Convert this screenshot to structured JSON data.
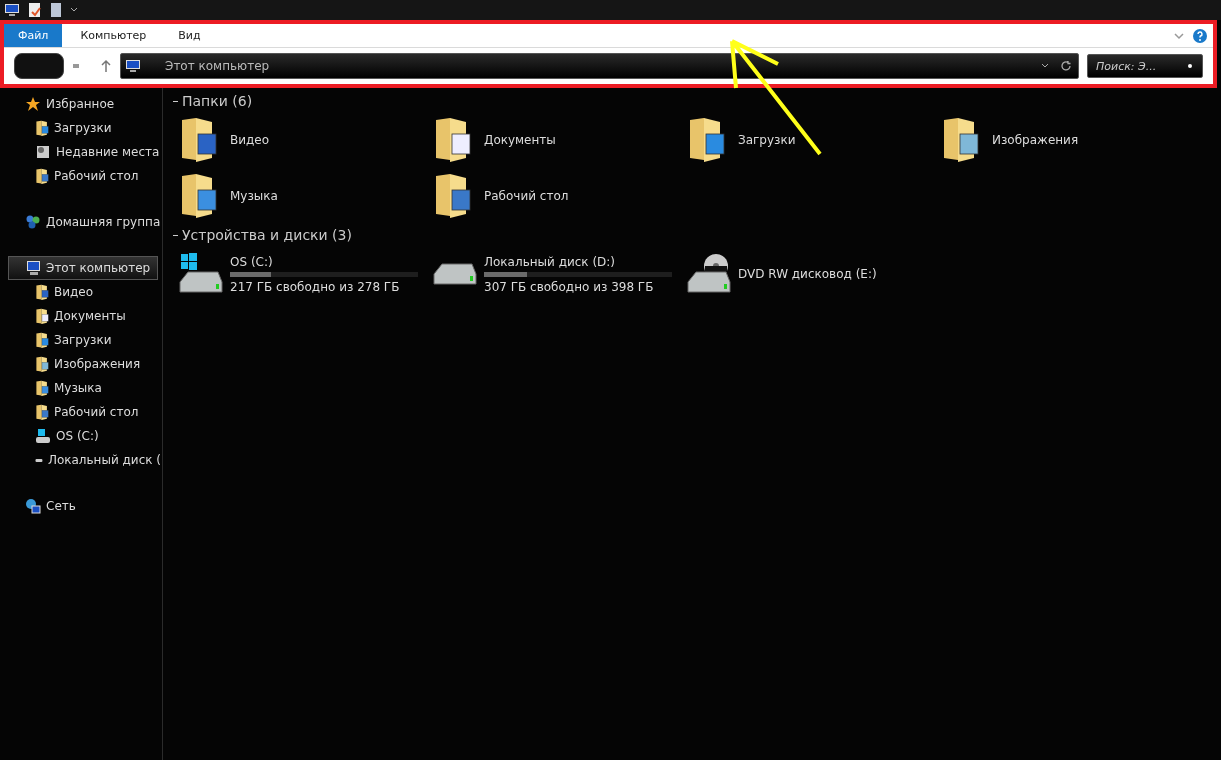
{
  "ribbon": {
    "tabs": [
      {
        "label": "Файл",
        "selected": true
      },
      {
        "label": "Компьютер",
        "selected": false
      },
      {
        "label": "Вид",
        "selected": false
      }
    ],
    "address": "Этот компьютер",
    "search": {
      "placeholder": "Поиск: Э..."
    }
  },
  "sidebar": {
    "groups": [
      {
        "label": "Избранное",
        "kind": "star",
        "selected": false,
        "children": [
          {
            "label": "Загрузки",
            "kind": "downloads",
            "selected": false
          },
          {
            "label": "Недавние места",
            "kind": "recent",
            "selected": false
          },
          {
            "label": "Рабочий стол",
            "kind": "desktop",
            "selected": false
          }
        ]
      },
      {
        "label": "Домашняя группа",
        "kind": "homegroup",
        "selected": false
      },
      {
        "label": "Этот компьютер",
        "kind": "computer",
        "selected": true,
        "children": [
          {
            "label": "Видео",
            "kind": "video",
            "selected": false
          },
          {
            "label": "Документы",
            "kind": "documents",
            "selected": false
          },
          {
            "label": "Загрузки",
            "kind": "downloads",
            "selected": false
          },
          {
            "label": "Изображения",
            "kind": "pictures",
            "selected": false
          },
          {
            "label": "Музыка",
            "kind": "music",
            "selected": false
          },
          {
            "label": "Рабочий стол",
            "kind": "desktop",
            "selected": false
          },
          {
            "label": "OS (C:)",
            "kind": "osdrive",
            "selected": false
          },
          {
            "label": "Локальный диск (",
            "kind": "drive",
            "selected": false
          }
        ]
      },
      {
        "label": "Сеть",
        "kind": "network",
        "selected": false
      }
    ]
  },
  "folders": {
    "title": "Папки (6)",
    "items": [
      {
        "label": "Видео",
        "kind": "video"
      },
      {
        "label": "Документы",
        "kind": "documents"
      },
      {
        "label": "Загрузки",
        "kind": "downloads"
      },
      {
        "label": "Изображения",
        "kind": "pictures"
      },
      {
        "label": "Музыка",
        "kind": "music"
      },
      {
        "label": "Рабочий стол",
        "kind": "desktop"
      }
    ]
  },
  "drives": {
    "title": "Устройства и диски (3)",
    "items": [
      {
        "label": "OS (C:)",
        "kind": "osdrive",
        "level": 0.22,
        "free": "217 ГБ свободно из 278 ГБ"
      },
      {
        "label": "Локальный диск (D:)",
        "kind": "drive",
        "level": 0.23,
        "free": "307 ГБ свободно из 398 ГБ"
      },
      {
        "label": "DVD RW дисковод (E:)",
        "kind": "dvd"
      }
    ]
  }
}
